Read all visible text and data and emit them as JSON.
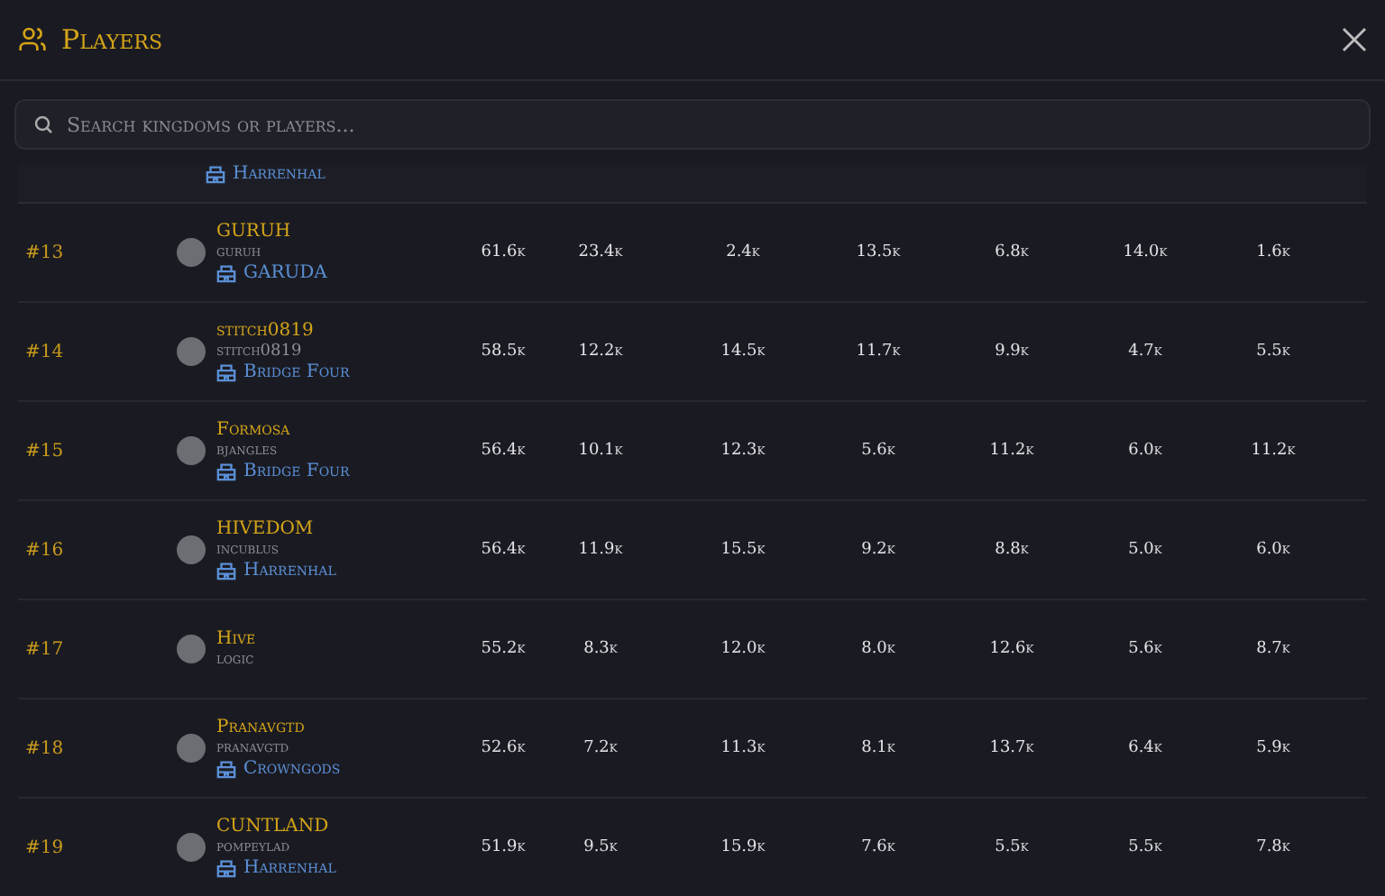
{
  "dialog": {
    "title": "Players",
    "search": {
      "placeholder": "Search kingdoms or players..."
    }
  },
  "partial_row": {
    "kingdom": "Harrenhal"
  },
  "rows": [
    {
      "rank": "#13",
      "name": "GURUH",
      "account": "guruh",
      "kingdom": "GARUDA",
      "stats": [
        "61.6k",
        "23.4k",
        "2.4k",
        "13.5k",
        "6.8k",
        "14.0k",
        "1.6k"
      ]
    },
    {
      "rank": "#14",
      "name": "stitch0819",
      "account": "stitch0819",
      "kingdom": "Bridge Four",
      "stats": [
        "58.5k",
        "12.2k",
        "14.5k",
        "11.7k",
        "9.9k",
        "4.7k",
        "5.5k"
      ]
    },
    {
      "rank": "#15",
      "name": "Formosa",
      "account": "bjangles",
      "kingdom": "Bridge Four",
      "stats": [
        "56.4k",
        "10.1k",
        "12.3k",
        "5.6k",
        "11.2k",
        "6.0k",
        "11.2k"
      ]
    },
    {
      "rank": "#16",
      "name": "HIVEDOM",
      "account": "incublus",
      "kingdom": "Harrenhal",
      "stats": [
        "56.4k",
        "11.9k",
        "15.5k",
        "9.2k",
        "8.8k",
        "5.0k",
        "6.0k"
      ]
    },
    {
      "rank": "#17",
      "name": "Hive",
      "account": "logic",
      "stats": [
        "55.2k",
        "8.3k",
        "12.0k",
        "8.0k",
        "12.6k",
        "5.6k",
        "8.7k"
      ]
    },
    {
      "rank": "#18",
      "name": "Pranavgtd",
      "account": "pranavgtd",
      "kingdom": "Crowngods",
      "stats": [
        "52.6k",
        "7.2k",
        "11.3k",
        "8.1k",
        "13.7k",
        "6.4k",
        "5.9k"
      ]
    },
    {
      "rank": "#19",
      "name": "CUNTLAND",
      "account": "pompeylad",
      "kingdom": "Harrenhal",
      "stats": [
        "51.9k",
        "9.5k",
        "15.9k",
        "7.6k",
        "5.5k",
        "5.5k",
        "7.8k"
      ]
    }
  ]
}
